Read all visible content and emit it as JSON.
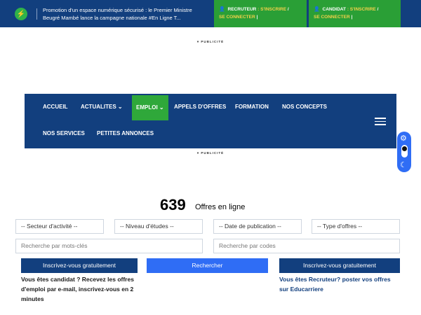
{
  "topbar": {
    "news": "Promotion d'un espace numérique sécurisé : le Premier Ministre Beugré Mambé lance la campagne nationale #En Ligne T...",
    "recruteur": {
      "role": "RECRUTEUR",
      "inscrire": "S'INSCRIRE",
      "connecter": "SE CONNECTER"
    },
    "candidat": {
      "role": "CANDIDAT",
      "inscrire": "S'INSCRIRE",
      "connecter": "SE CONNECTER"
    },
    "separator": ":",
    "slash": "/",
    "pipe": "|"
  },
  "ads": {
    "label": "PUBLICITÉ"
  },
  "nav": {
    "items": [
      "ACCUEIL",
      "ACTUALITES",
      "EMPLOI",
      "APPELS D'OFFRES",
      "FORMATION",
      "NOS CONCEPTS",
      "NOS SERVICES",
      "PETITES ANNONCES"
    ]
  },
  "offers": {
    "count": "639",
    "label": "Offres en ligne"
  },
  "filters": {
    "sector": "-- Secteur d'activité --",
    "level": "-- Niveau d'études --",
    "date": "-- Date de publication --",
    "type": "-- Type d'offres --",
    "keywords_placeholder": "Recherche par mots-clés",
    "codes_placeholder": "Recherche par codes"
  },
  "buttons": {
    "signup_left": "Inscrivez-vous gratuitement",
    "search": "Rechercher",
    "signup_right": "Inscrivez-vous gratuitement"
  },
  "notes": {
    "candidate": "Vous êtes candidat ? Recevez les offres d'emploi par e-mail, inscrivez-vous en 2 minutes",
    "recruiter": "Vous êtes Recruteur? poster vos offres sur Educarriere"
  },
  "icons": [
    "flash-icon",
    "user-icon",
    "chevron-down-icon",
    "menu-icon",
    "gear-icon",
    "moon-icon"
  ],
  "colors": {
    "navy": "#123f7e",
    "green": "#2a9f36",
    "blue": "#2f6df5",
    "yellow": "#f2d04a"
  }
}
